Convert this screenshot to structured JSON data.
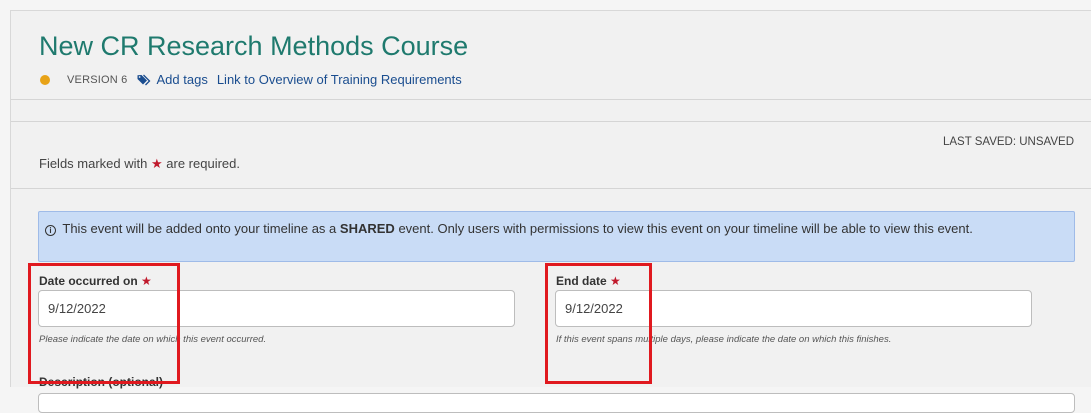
{
  "header": {
    "title": "New CR Research Methods Course",
    "version": "VERSION 6",
    "add_tags": "Add tags",
    "overview_link": "Link to Overview of Training Requirements",
    "status_color": "#e8a317"
  },
  "form": {
    "last_saved": "LAST SAVED: UNSAVED",
    "required_prefix": "Fields marked with",
    "required_suffix": "are required.",
    "required_star": "★",
    "info": {
      "pre": "This event will be added onto your timeline as a",
      "bold": "SHARED",
      "post": "event. Only users with permissions to view this event on your timeline will be able to view this event."
    },
    "date_occurred": {
      "label": "Date occurred on",
      "value": "9/12/2022",
      "help": "Please indicate the date on which this event occurred."
    },
    "end_date": {
      "label": "End date",
      "value": "9/12/2022",
      "help": "If this event spans multiple days, please indicate the date on which this finishes."
    },
    "description": {
      "label": "Description (optional)"
    }
  },
  "colors": {
    "title": "#1f7a6e",
    "link": "#1a4d8f",
    "required_star": "#c0192c",
    "info_bg": "#c9dcf6",
    "highlight": "#e0191f"
  }
}
